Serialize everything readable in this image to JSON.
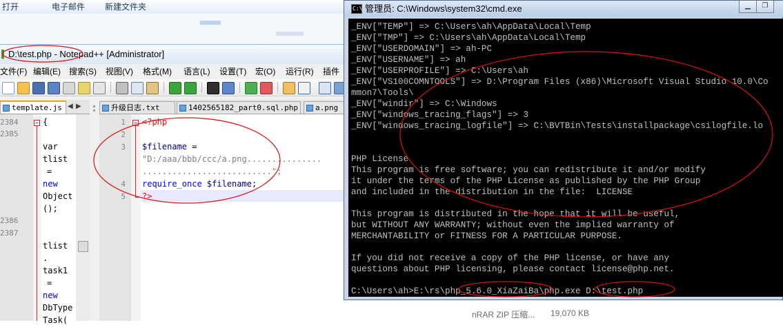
{
  "explorer": {
    "commands": [
      "打开",
      "电子邮件",
      "新建文件夹"
    ],
    "file_type": "nRAR ZIP 压缩...",
    "file_size": "19,070 KB"
  },
  "notepad": {
    "title": "D:\\test.php - Notepad++ [Administrator]",
    "menu": [
      "文件(F)",
      "编辑(E)",
      "搜索(S)",
      "视图(V)",
      "格式(M)",
      "语言(L)",
      "设置(T)",
      "宏(O)",
      "运行(R)",
      "插件"
    ],
    "left_tabs": [
      "template.js"
    ],
    "right_tabs": [
      "升级日志.txt",
      "1402565182_part0.sql.php",
      "a.png"
    ],
    "left_line_numbers": [
      "2384",
      "2385",
      "2386",
      "2387"
    ],
    "left_code": [
      "{",
      "var",
      "tlist",
      "=",
      "new",
      "Object",
      "();",
      "tlist",
      ".",
      "task1",
      "=",
      "new",
      "DbType",
      "Task("
    ],
    "right_line_numbers": [
      "1",
      "2",
      "3",
      "4",
      "5"
    ],
    "code": {
      "line1": "<?php",
      "line3a": "$filename",
      "line3b": " =",
      "line3c": "\"D:/aaa/bbb/ccc/a.png...............",
      "line3d": "..........................\";",
      "line4a": "require_once",
      "line4b": " $filename;",
      "line5": "?>"
    }
  },
  "cmd": {
    "title": "管理员: C:\\Windows\\system32\\cmd.exe",
    "lines": [
      "_ENV[\"TEMP\"] => C:\\Users\\ah\\AppData\\Local\\Temp",
      "_ENV[\"TMP\"] => C:\\Users\\ah\\AppData\\Local\\Temp",
      "_ENV[\"USERDOMAIN\"] => ah-PC",
      "_ENV[\"USERNAME\"] => ah",
      "_ENV[\"USERPROFILE\"] => C:\\Users\\ah",
      "_ENV[\"VS100COMNTOOLS\"] => D:\\Program Files (x86)\\Microsoft Visual Studio 10.0\\Co",
      "mmon7\\Tools\\",
      "_ENV[\"windir\"] => C:\\Windows",
      "_ENV[\"windows_tracing_flags\"] => 3",
      "_ENV[\"windows_tracing_logfile\"] => C:\\BVTBin\\Tests\\installpackage\\csilogfile.lo",
      "",
      "",
      "PHP License",
      "This program is free software; you can redistribute it and/or modify",
      "it under the terms of the PHP License as published by the PHP Group",
      "and included in the distribution in the file:  LICENSE",
      "",
      "This program is distributed in the hope that it will be useful,",
      "but WITHOUT ANY WARRANTY; without even the implied warranty of",
      "MERCHANTABILITY or FITNESS FOR A PARTICULAR PURPOSE.",
      "",
      "If you did not receive a copy of the PHP license, or have any",
      "questions about PHP licensing, please contact license@php.net.",
      "",
      "C:\\Users\\ah>E:\\rs\\php_5.6.0_XiaZaiBa\\php.exe D:\\test.php"
    ]
  },
  "colors": {
    "annotation": "#e01010",
    "keyword": "#0000ff",
    "php_tag": "#ff0000",
    "console_text": "#c0c0c0",
    "console_bg": "#000000"
  }
}
